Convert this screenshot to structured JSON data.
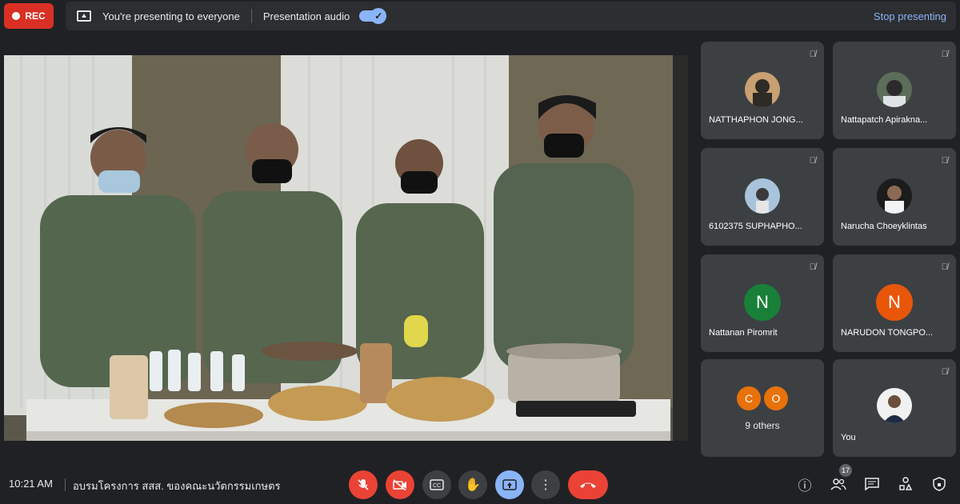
{
  "top_bar": {
    "rec_label": "REC",
    "presenting_text": "You're presenting to everyone",
    "audio_label": "Presentation audio",
    "stop_label": "Stop presenting"
  },
  "participants": [
    {
      "name": "NATTHAPHON JONG...",
      "avatar": "photo"
    },
    {
      "name": "Nattapatch Apiraknа...",
      "avatar": "photo"
    },
    {
      "name": "6102375 SUPHAPHO...",
      "avatar": "photo"
    },
    {
      "name": "Narucha Choeyklintas",
      "avatar": "photo"
    },
    {
      "name": "Nattanan Piromrit",
      "initial": "N",
      "color": "#188038"
    },
    {
      "name": "NARUDON TONGPO...",
      "initial": "N",
      "color": "#e8560a"
    }
  ],
  "others": {
    "initials": [
      "C",
      "O"
    ],
    "label": "9 others"
  },
  "you": {
    "name": "You"
  },
  "bottom_bar": {
    "time": "10:21 AM",
    "meeting_title": "อบรมโครงการ สสส. ของคณะนวัตกรรมเกษตร",
    "participant_count": "17",
    "controls": [
      "mic-off-icon",
      "camera-off-icon",
      "captions-icon",
      "raise-hand-icon",
      "present-icon",
      "more-icon",
      "end-call-icon"
    ],
    "right_icons": [
      "info-icon",
      "people-icon",
      "chat-icon",
      "activities-icon",
      "host-controls-icon"
    ]
  },
  "colors": {
    "accent": "#8ab4f8",
    "danger": "#ea4335",
    "tile_bg": "#3c4043"
  }
}
